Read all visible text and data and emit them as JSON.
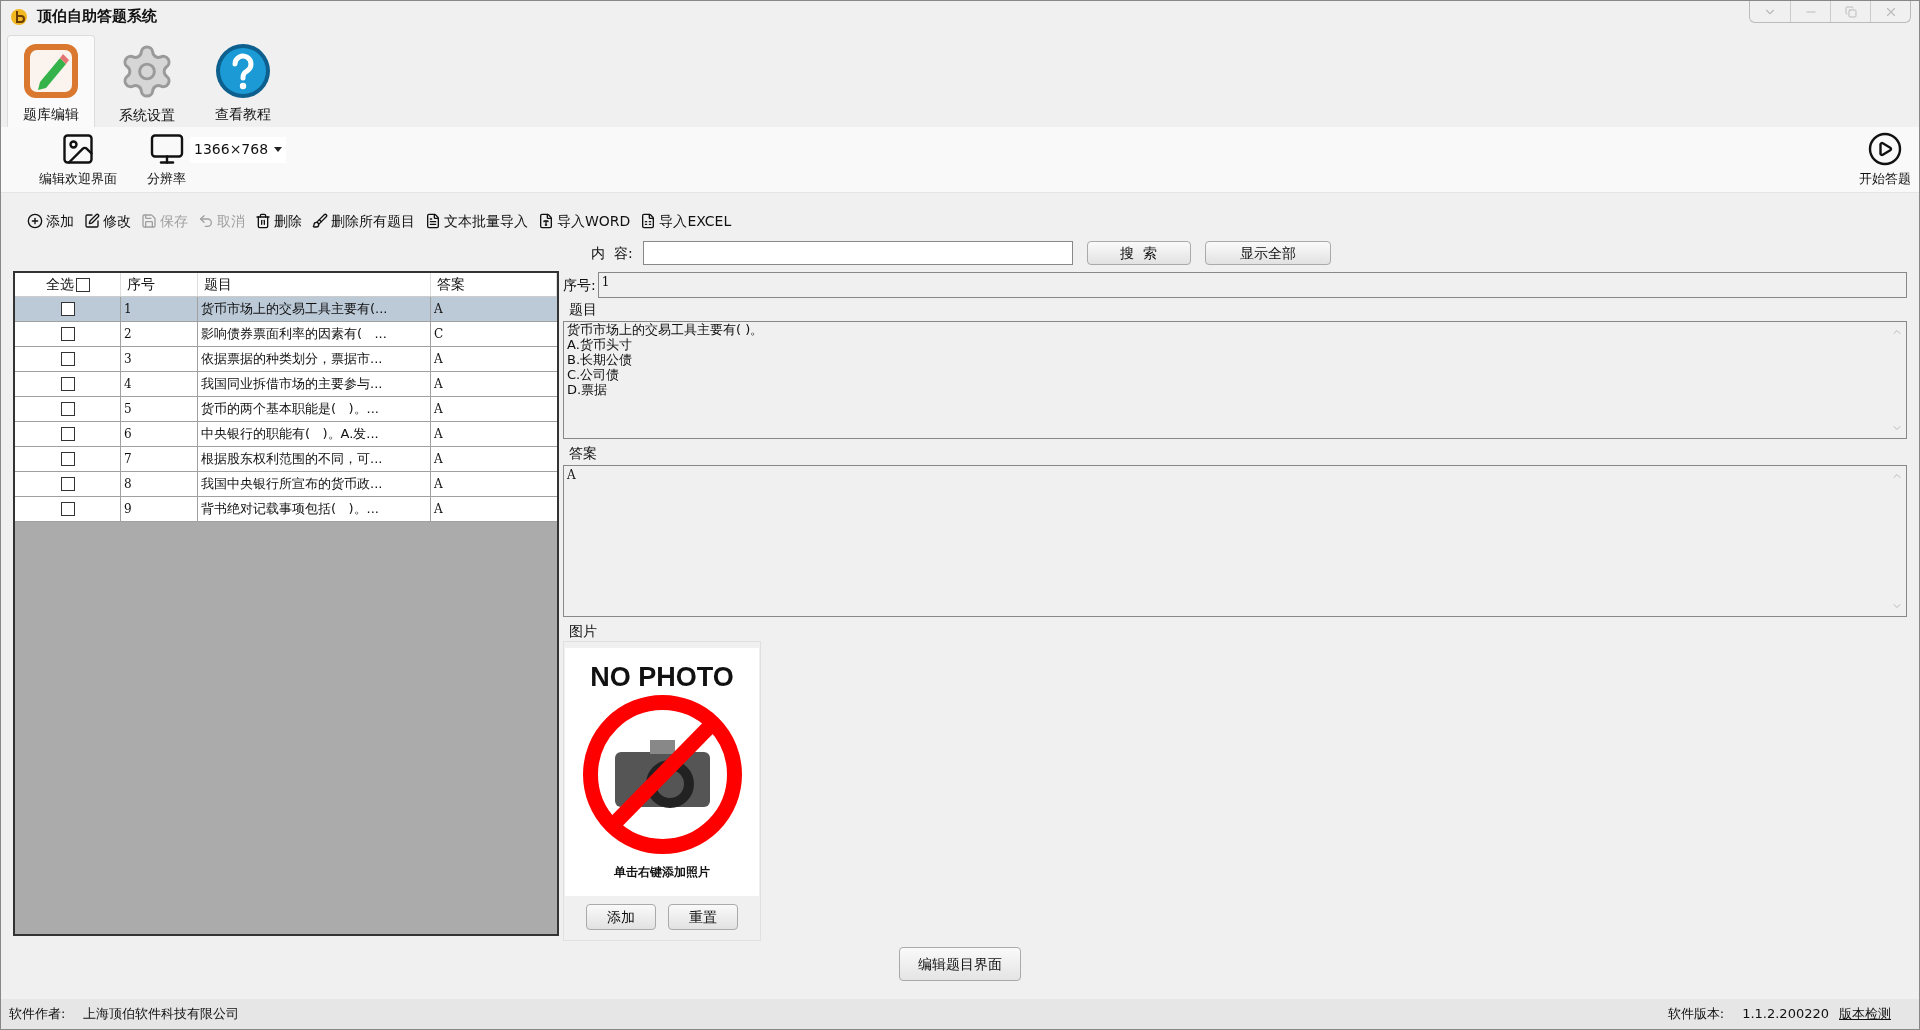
{
  "window": {
    "title": "顶伯自助答题系统"
  },
  "ribbon_tabs": [
    {
      "label": "题库编辑",
      "selected": true,
      "kind": "edit"
    },
    {
      "label": "系统设置",
      "selected": false,
      "kind": "gear"
    },
    {
      "label": "查看教程",
      "selected": false,
      "kind": "help"
    }
  ],
  "ribbon": {
    "items": [
      {
        "label": "编辑欢迎界面",
        "kind": "image"
      },
      {
        "label": "分辨率",
        "kind": "monitor"
      }
    ],
    "resolution": "1366×768",
    "start_button": "开始答题"
  },
  "toolbar": [
    {
      "label": "添加",
      "kind": "add",
      "disabled": false
    },
    {
      "label": "修改",
      "kind": "edit",
      "disabled": false
    },
    {
      "label": "保存",
      "kind": "save",
      "disabled": true
    },
    {
      "label": "取消",
      "kind": "undo",
      "disabled": true
    },
    {
      "label": "删除",
      "kind": "delete",
      "disabled": false
    },
    {
      "label": "删除所有题目",
      "kind": "clear",
      "disabled": false
    },
    {
      "label": "文本批量导入",
      "kind": "text",
      "disabled": false
    },
    {
      "label": "导入WORD",
      "kind": "word",
      "disabled": false
    },
    {
      "label": "导入EXCEL",
      "kind": "excel",
      "disabled": false
    }
  ],
  "search": {
    "label": "内  容:",
    "search_button": "搜  索",
    "show_all_button": "显示全部"
  },
  "table": {
    "columns": [
      "全选",
      "序号",
      "题目",
      "答案"
    ],
    "select_all_checked": false,
    "rows": [
      {
        "no": "1",
        "question": "货币市场上的交易工具主要有(...",
        "answer": "A",
        "selected": true,
        "checked": false
      },
      {
        "no": "2",
        "question": "影响债券票面利率的因素有(   ...",
        "answer": "C",
        "selected": false,
        "checked": false
      },
      {
        "no": "3",
        "question": "依据票据的种类划分，票据市...",
        "answer": "A",
        "selected": false,
        "checked": false
      },
      {
        "no": "4",
        "question": "我国同业拆借市场的主要参与...",
        "answer": "A",
        "selected": false,
        "checked": false
      },
      {
        "no": "5",
        "question": "货币的两个基本职能是(   )。...",
        "answer": "A",
        "selected": false,
        "checked": false
      },
      {
        "no": "6",
        "question": "中央银行的职能有(   )。A.发...",
        "answer": "A",
        "selected": false,
        "checked": false
      },
      {
        "no": "7",
        "question": "根据股东权利范围的不同，可...",
        "answer": "A",
        "selected": false,
        "checked": false
      },
      {
        "no": "8",
        "question": "我国中央银行所宣布的货币政...",
        "answer": "A",
        "selected": false,
        "checked": false
      },
      {
        "no": "9",
        "question": "背书绝对记载事项包括(   )。...",
        "answer": "A",
        "selected": false,
        "checked": false
      }
    ]
  },
  "detail": {
    "number_label": "序号:",
    "number": "1",
    "question_label": "题目",
    "question": "货币市场上的交易工具主要有(   )。\nA.货币头寸\nB.长期公债\nC.公司债\nD.票据",
    "answer_label": "答案",
    "answer": "A",
    "image_label": "图片",
    "image_title": "NO PHOTO",
    "image_hint": "单击右键添加照片",
    "image_buttons": [
      "添加",
      "重置"
    ]
  },
  "edit_button": "编辑题目界面",
  "status_bar": {
    "author_label": "软件作者:",
    "author": "上海顶伯软件科技有限公司",
    "version_label": "软件版本:",
    "version": "1.1.2.200220",
    "check_link": "版本检测"
  }
}
